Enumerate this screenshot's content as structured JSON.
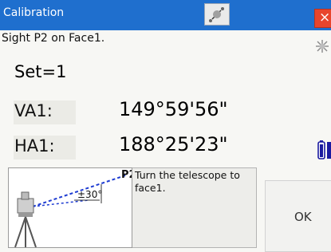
{
  "window": {
    "title": "Calibration",
    "close_label": "×"
  },
  "status_icons": [
    "connection-icon",
    "sun-icon",
    "battery-icon"
  ],
  "instruction": "Sight P2 on Face1.",
  "set": "Set=1",
  "readings": [
    {
      "label": "VA1:",
      "value": "149°59'56\""
    },
    {
      "label": "HA1:",
      "value": "188°25'23\""
    }
  ],
  "figure": {
    "point_label": "P2",
    "angle_label": "±30°"
  },
  "hint": "Turn the telescope to face1.",
  "ok_label": "OK",
  "colors": {
    "titlebar": "#1f6fce",
    "close": "#e8452c",
    "sight_line": "#1e3cd2"
  }
}
